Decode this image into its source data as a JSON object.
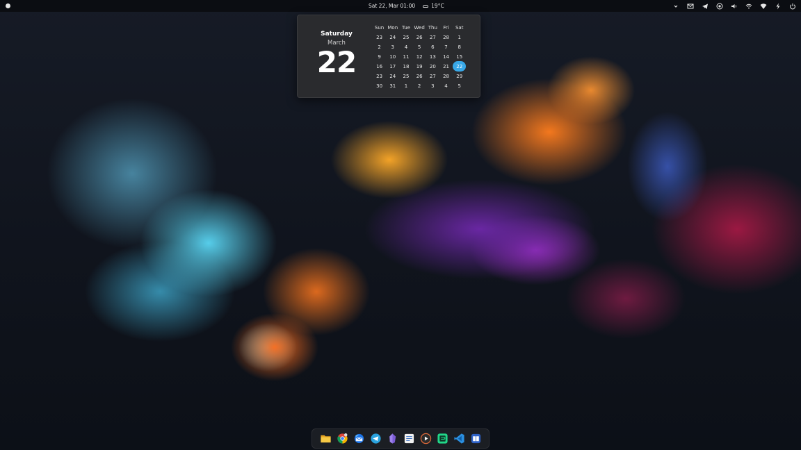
{
  "topbar": {
    "datetime": "Sat 22, Mar 01:00",
    "weather": "19°C"
  },
  "tray_icons": [
    "chevron-down-icon",
    "email-icon",
    "telegram-icon",
    "screen-record-icon",
    "volume-icon",
    "wifi-icon",
    "network-icon",
    "power-profile-icon",
    "power-icon"
  ],
  "calendar": {
    "weekday": "Saturday",
    "month": "March",
    "day": "22",
    "headers": [
      "Sun",
      "Mon",
      "Tue",
      "Wed",
      "Thu",
      "Fri",
      "Sat"
    ],
    "days": [
      "23",
      "24",
      "25",
      "26",
      "27",
      "28",
      "1",
      "2",
      "3",
      "4",
      "5",
      "6",
      "7",
      "8",
      "9",
      "10",
      "11",
      "12",
      "13",
      "14",
      "15",
      "16",
      "17",
      "18",
      "19",
      "20",
      "21",
      "22",
      "23",
      "24",
      "25",
      "26",
      "27",
      "28",
      "29",
      "30",
      "31",
      "1",
      "2",
      "3",
      "4",
      "5"
    ],
    "today_index": 27,
    "accent": "#38a8e8"
  },
  "dock_apps": [
    "files-icon",
    "chrome-icon",
    "thunderbird-icon",
    "telegram-icon",
    "obsidian-icon",
    "text-editor-icon",
    "video-player-icon",
    "pycharm-icon",
    "vscode-icon",
    "reader-icon"
  ]
}
